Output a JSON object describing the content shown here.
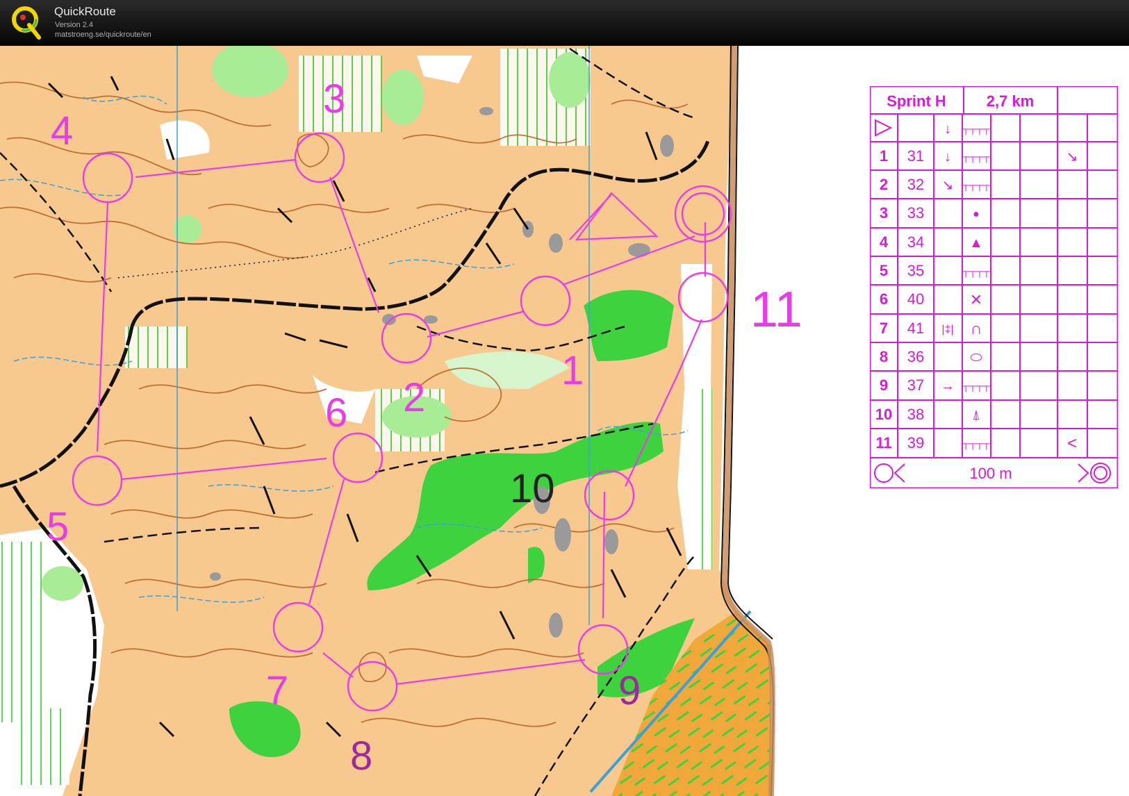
{
  "app": {
    "title": "QuickRoute",
    "version": "Version 2.4",
    "url": "matstroeng.se/quickroute/en"
  },
  "course": {
    "name": "Sprint H",
    "length": "2,7 km",
    "scale_label": "100 m",
    "controls": [
      {
        "num": "1",
        "code": "31",
        "direction": "↓",
        "feature": "┬┬┬┬",
        "extra": "↘"
      },
      {
        "num": "2",
        "code": "32",
        "direction": "↘",
        "feature": "┬┬┬┬",
        "extra": ""
      },
      {
        "num": "3",
        "code": "33",
        "direction": "",
        "feature": "●",
        "extra": ""
      },
      {
        "num": "4",
        "code": "34",
        "direction": "",
        "feature": "▲",
        "extra": ""
      },
      {
        "num": "5",
        "code": "35",
        "direction": "",
        "feature": "┬┬┬┬",
        "extra": ""
      },
      {
        "num": "6",
        "code": "40",
        "direction": "",
        "feature": "✕",
        "extra": ""
      },
      {
        "num": "7",
        "code": "41",
        "direction": "|‡|",
        "feature": "∩",
        "extra": ""
      },
      {
        "num": "8",
        "code": "36",
        "direction": "",
        "feature": "⬭",
        "extra": ""
      },
      {
        "num": "9",
        "code": "37",
        "direction": "→",
        "feature": "┬┬┬┬",
        "extra": ""
      },
      {
        "num": "10",
        "code": "38",
        "direction": "",
        "feature": "⍋",
        "extra": ""
      },
      {
        "num": "11",
        "code": "39",
        "direction": "",
        "feature": "┬┬┬┬",
        "extra": "<"
      }
    ]
  },
  "map_labels": [
    {
      "text": "1",
      "color": "#e83ce8"
    },
    {
      "text": "2",
      "color": "#e83ce8"
    },
    {
      "text": "3",
      "color": "#e83ce8"
    },
    {
      "text": "4",
      "color": "#e83ce8"
    },
    {
      "text": "5",
      "color": "#e83ce8"
    },
    {
      "text": "6",
      "color": "#e83ce8"
    },
    {
      "text": "7",
      "color": "#e83ce8"
    },
    {
      "text": "8",
      "color": "#9b2b9b"
    },
    {
      "text": "9",
      "color": "#9b2b9b"
    },
    {
      "text": "10",
      "color": "#222222"
    },
    {
      "text": "11",
      "color": "#e83ce8"
    }
  ],
  "colors": {
    "course": "#e83ce8",
    "terrain_open": "#f8c98e",
    "vegetation": "#3ed23e",
    "contour": "#b8642a",
    "water": "#3aa0d8"
  }
}
